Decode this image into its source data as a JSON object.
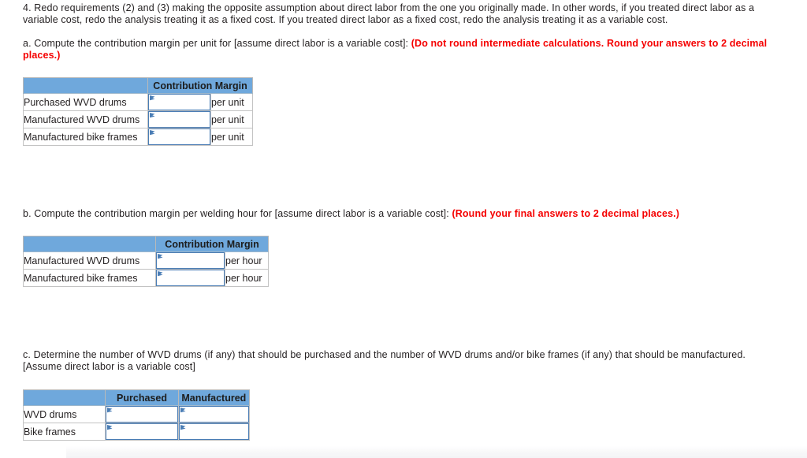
{
  "document": {
    "question_number": "4.",
    "intro": "4. Redo requirements (2) and (3) making the opposite assumption about direct labor from the one you originally made. In other words, if you treated direct labor as a variable cost, redo the analysis treating it as a fixed cost. If you treated direct labor as a fixed cost, redo the analysis treating it as a variable cost.",
    "parts": {
      "a": {
        "prompt": "a. Compute the contribution margin per unit for [assume direct labor is a variable cost]:",
        "instruction": "(Do not round intermediate calculations. Round your answers to 2 decimal places.)",
        "instruction_color": "#f50000",
        "table": {
          "headers": [
            "",
            "Contribution Margin",
            ""
          ],
          "rows": [
            {
              "label": "Purchased WVD drums",
              "value": "",
              "unit": "per unit"
            },
            {
              "label": "Manufactured WVD drums",
              "value": "",
              "unit": "per unit"
            },
            {
              "label": "Manufactured bike frames",
              "value": "",
              "unit": "per unit"
            }
          ]
        }
      },
      "b": {
        "prompt": "b. Compute the contribution margin per welding hour for [assume direct labor is a variable cost]:",
        "instruction": "(Round your final answers to 2 decimal places.)",
        "instruction_color": "#f50000",
        "table": {
          "headers": [
            "",
            "Contribution Margin",
            ""
          ],
          "rows": [
            {
              "label": "Manufactured WVD drums",
              "value": "",
              "unit": "per hour"
            },
            {
              "label": "Manufactured bike frames",
              "value": "",
              "unit": "per hour"
            }
          ]
        }
      },
      "c": {
        "prompt": "c. Determine the number of WVD drums (if any) that should be purchased and the number of WVD drums and/or bike frames (if any) that should be manufactured.",
        "prompt_line2": "[Assume direct labor is a variable cost]",
        "table": {
          "headers": [
            "",
            "Purchased",
            "Manufactured"
          ],
          "rows": [
            {
              "label": "WVD drums",
              "purchased": "",
              "manufactured": ""
            },
            {
              "label": "Bike frames",
              "purchased": "",
              "manufactured": ""
            }
          ]
        }
      }
    },
    "input_placeholder": "",
    "colors": {
      "header_blue": "#6fa8dc",
      "input_border": "#4a7db5",
      "cell_border": "#c3c3c3",
      "text": "#231f20",
      "emphasis_red": "#f50000"
    }
  }
}
